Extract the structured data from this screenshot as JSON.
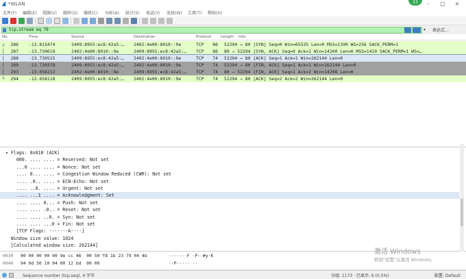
{
  "window": {
    "title": "*WLAN",
    "badge": "53"
  },
  "menu": [
    "文件(F)",
    "编辑(E)",
    "视图(V)",
    "跳转(G)",
    "捕获(C)",
    "分析(A)",
    "统计(S)",
    "电话(Y)",
    "无线(W)",
    "工具(T)",
    "帮助(H)"
  ],
  "filter": {
    "value": "tcp.stream eq 79",
    "expression_label": "表达式…",
    "dropdown": "▾"
  },
  "columns": [
    "No.",
    "Time",
    "Source",
    "Destination",
    "Protocol",
    "Length",
    "Info"
  ],
  "packets": [
    {
      "no": "286",
      "time": "-13.815474",
      "src": "2409:8955:ec8:42a5:…",
      "dst": "2402:4e00:8010::9e",
      "proto": "TCP",
      "len": "86",
      "info": "52294 → 80 [SYN] Seq=0 Win=65535 Len=0 MSS=1390 WS=256 SACK_PERM=1",
      "bg": "#e4ffc7",
      "marker": "┌"
    },
    {
      "no": "287",
      "time": "-13.730619",
      "src": "2402:4e00:8010::9e",
      "dst": "2409:8955:ec8:42a5:…",
      "proto": "TCP",
      "len": "86",
      "info": "80 → 52294 [SYN, ACK] Seq=0 Ack=1 Win=14200 Len=0 MSS=1410 SACK_PERM=1 WS=…",
      "bg": "#e4ffc7",
      "marker": "│"
    },
    {
      "no": "288",
      "time": "-13.730515",
      "src": "2409:8955:ec8:42a5:…",
      "dst": "2402:4e00:8010::9e",
      "proto": "TCP",
      "len": "74",
      "info": "52294 → 80 [ACK] Seq=1 Ack=1 Win=262144 Len=0",
      "bg": "#dde8f6",
      "marker": "│"
    },
    {
      "no": "289",
      "time": "-13.730378",
      "src": "2409:8955:ec8:42a5:…",
      "dst": "2402:4e00:8010::9e",
      "proto": "TCP",
      "len": "74",
      "info": "52294 → 80 [FIN, ACK] Seq=1 Ack=1 Win=262144 Len=0",
      "bg": "#a0a0a0",
      "marker": "│"
    },
    {
      "no": "293",
      "time": "-13.658212",
      "src": "2402:4e00:8010::9e",
      "dst": "2409:8955:ec8:42a5:…",
      "proto": "TCP",
      "len": "74",
      "info": "80 → 52294 [FIN, ACK] Seq=1 Ack=2 Win=14208 Len=0",
      "bg": "#a0a0a0",
      "marker": "│"
    },
    {
      "no": "294",
      "time": "-13.658118",
      "src": "2409:8955:ec8:42a5:…",
      "dst": "2402:4e00:8010::9e",
      "proto": "TCP",
      "len": "74",
      "info": "52294 → 80 [ACK] Seq=2 Ack=2 Win=262144 Len=0",
      "bg": "#e4ffc7",
      "marker": "└"
    }
  ],
  "details": [
    {
      "text": "  ▾ Flags: 0x010 (ACK)",
      "hl": false
    },
    {
      "text": "      000. .... .... = Reserved: Not set",
      "hl": false
    },
    {
      "text": "      ...0 .... .... = Nonce: Not set",
      "hl": false
    },
    {
      "text": "      .... 0... .... = Congestion Window Reduced (CWR): Not set",
      "hl": false
    },
    {
      "text": "      .... .0.. .... = ECN-Echo: Not set",
      "hl": false
    },
    {
      "text": "      .... ..0. .... = Urgent: Not set",
      "hl": false
    },
    {
      "text": "      .... ...1 .... = Acknowledgment: Set",
      "hl": true
    },
    {
      "text": "      .... .... 0... = Push: Not set",
      "hl": false
    },
    {
      "text": "      .... .... .0.. = Reset: Not set",
      "hl": false
    },
    {
      "text": "      .... .... ..0. = Syn: Not set",
      "hl": false
    },
    {
      "text": "      .... .... ...0 = Fin: Not set",
      "hl": false
    },
    {
      "text": "      [TCP Flags: ·······A····]",
      "hl": false
    },
    {
      "text": "    Window size value: 1024",
      "hl": false
    },
    {
      "text": "    [Calculated window size: 262144]",
      "hl": false
    }
  ],
  "hex": [
    {
      "off": "0030",
      "bytes": "00 00 00 00 00 9e cc 46  00 50 f8 1b 23 79 04 4b",
      "ascii": "·······F ·P··#y·K"
    },
    {
      "off": "0040",
      "bytes": "94 9d 50 10 04 00 12 bd  00 00",
      "ascii": "··P····· ··"
    }
  ],
  "status": {
    "field": "Sequence number (tcp.seq), 4 字节",
    "packets": "分组: 1173 · 已显示: 6 (0.5%)",
    "profile": "配置: Default"
  },
  "watermark": {
    "line1": "激活 Windows",
    "line2": "转到\"设置\"以激活 Windows。"
  }
}
